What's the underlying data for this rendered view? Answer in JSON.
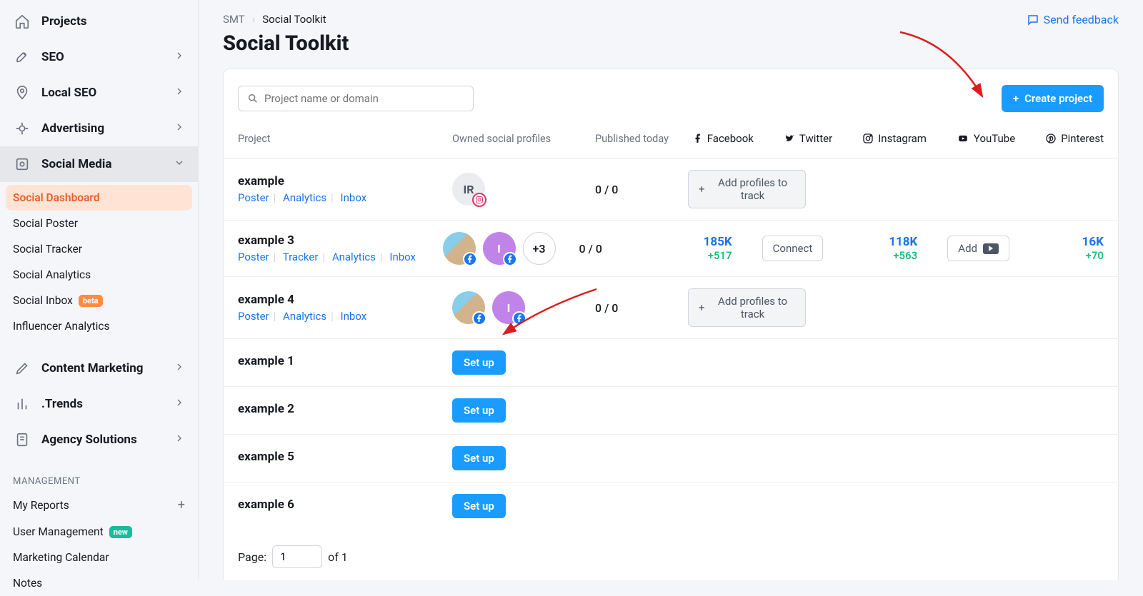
{
  "nav": {
    "projects": "Projects",
    "seo": "SEO",
    "local_seo": "Local SEO",
    "advertising": "Advertising",
    "social_media": "Social Media",
    "content_marketing": "Content Marketing",
    "trends": ".Trends",
    "agency": "Agency Solutions"
  },
  "subnav": {
    "dashboard": "Social Dashboard",
    "poster": "Social Poster",
    "tracker": "Social Tracker",
    "analytics": "Social Analytics",
    "inbox": "Social Inbox",
    "inbox_badge": "beta",
    "influencer": "Influencer Analytics"
  },
  "mgmt": {
    "label": "MANAGEMENT",
    "my_reports": "My Reports",
    "user_mgmt": "User Management",
    "user_mgmt_badge": "new",
    "calendar": "Marketing Calendar",
    "notes": "Notes"
  },
  "breadcrumb": {
    "root": "SMT",
    "cur": "Social Toolkit"
  },
  "feedback": "Send feedback",
  "title": "Social Toolkit",
  "search_placeholder": "Project name or domain",
  "create_btn": "Create project",
  "headers": {
    "project": "Project",
    "profiles": "Owned social profiles",
    "published": "Published today",
    "facebook": "Facebook",
    "twitter": "Twitter",
    "instagram": "Instagram",
    "youtube": "YouTube",
    "pinterest": "Pinterest"
  },
  "links": {
    "poster": "Poster",
    "tracker": "Tracker",
    "analytics": "Analytics",
    "inbox": "Inbox"
  },
  "rows": {
    "r1": {
      "name": "example",
      "avatar_text": "IR",
      "pub": "0 / 0",
      "add_btn": "Add profiles to track"
    },
    "r2": {
      "name": "example 3",
      "more": "+3",
      "pub": "0 / 0",
      "fb_val": "185K",
      "fb_delta": "+517",
      "tw_btn": "Connect",
      "ig_val": "118K",
      "ig_delta": "+563",
      "yt_btn": "Add",
      "pin_val": "16K",
      "pin_delta": "+70"
    },
    "r3": {
      "name": "example 4",
      "pub": "0 / 0",
      "add_btn": "Add profiles to track"
    },
    "r4": {
      "name": "example 1",
      "setup": "Set up"
    },
    "r5": {
      "name": "example 2",
      "setup": "Set up"
    },
    "r6": {
      "name": "example 5",
      "setup": "Set up"
    },
    "r7": {
      "name": "example 6",
      "setup": "Set up"
    }
  },
  "pager": {
    "label": "Page:",
    "value": "1",
    "of": "of 1"
  }
}
